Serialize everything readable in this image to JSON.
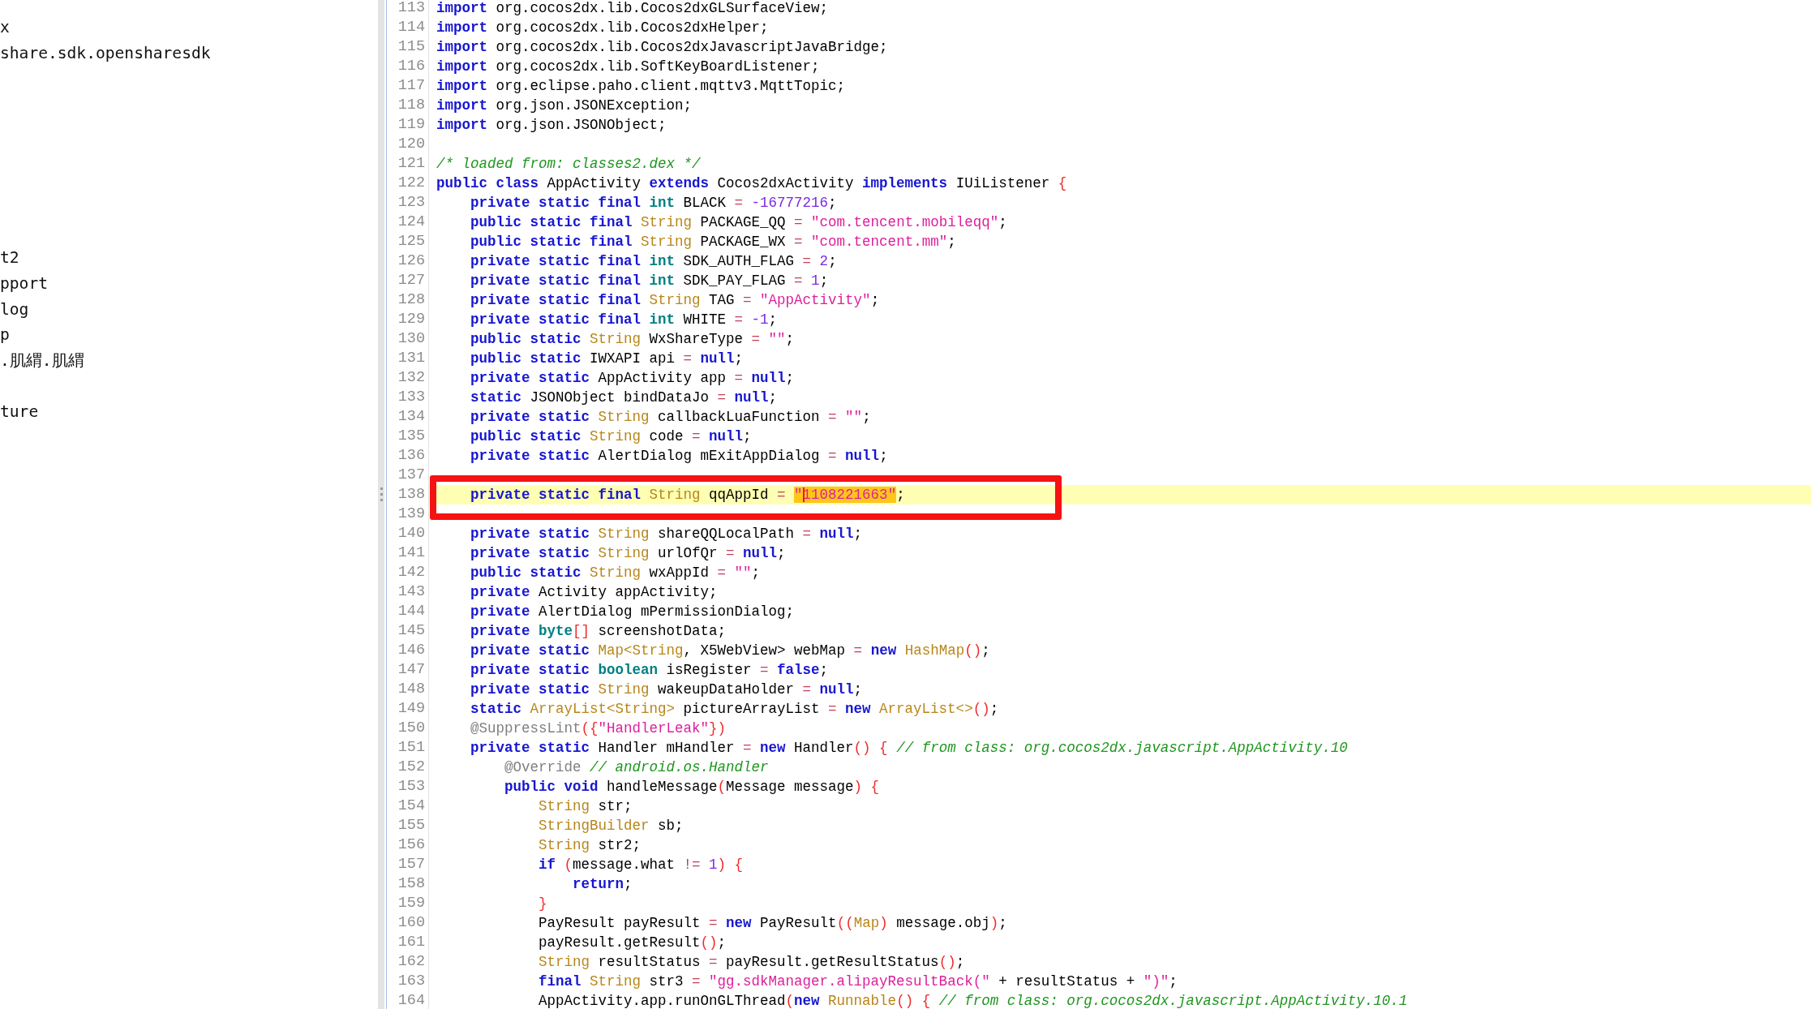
{
  "tree": {
    "items": [
      {
        "label": "x"
      },
      {
        "label": "share.sdk.opensharesdk"
      },
      {
        "label": "t2"
      },
      {
        "label": "pport"
      },
      {
        "label": "log"
      },
      {
        "label": "p"
      },
      {
        "label": ".肌緭.肌緭"
      },
      {
        "label": "ture"
      }
    ]
  },
  "lines": [
    {
      "number": "113",
      "selected": false,
      "boxed": false,
      "tokens": [
        {
          "kind": "kw",
          "text": "import"
        },
        {
          "kind": "plain",
          "text": " org.cocos2dx.lib.Cocos2dxGLSurfaceView;"
        }
      ]
    },
    {
      "number": "114",
      "selected": false,
      "boxed": false,
      "tokens": [
        {
          "kind": "kw",
          "text": "import"
        },
        {
          "kind": "plain",
          "text": " org.cocos2dx.lib.Cocos2dxHelper;"
        }
      ]
    },
    {
      "number": "115",
      "selected": false,
      "boxed": false,
      "tokens": [
        {
          "kind": "kw",
          "text": "import"
        },
        {
          "kind": "plain",
          "text": " org.cocos2dx.lib.Cocos2dxJavascriptJavaBridge;"
        }
      ]
    },
    {
      "number": "116",
      "selected": false,
      "boxed": false,
      "tokens": [
        {
          "kind": "kw",
          "text": "import"
        },
        {
          "kind": "plain",
          "text": " org.cocos2dx.lib.SoftKeyBoardListener;"
        }
      ]
    },
    {
      "number": "117",
      "selected": false,
      "boxed": false,
      "tokens": [
        {
          "kind": "kw",
          "text": "import"
        },
        {
          "kind": "plain",
          "text": " org.eclipse.paho.client.mqttv3.MqttTopic;"
        }
      ]
    },
    {
      "number": "118",
      "selected": false,
      "boxed": false,
      "tokens": [
        {
          "kind": "kw",
          "text": "import"
        },
        {
          "kind": "plain",
          "text": " org.json.JSONException;"
        }
      ]
    },
    {
      "number": "119",
      "selected": false,
      "boxed": false,
      "tokens": [
        {
          "kind": "kw",
          "text": "import"
        },
        {
          "kind": "plain",
          "text": " org.json.JSONObject;"
        }
      ]
    },
    {
      "number": "120",
      "selected": false,
      "boxed": false
    },
    {
      "number": "121",
      "selected": false,
      "boxed": false,
      "tokens": [
        {
          "kind": "com",
          "text": "/* loaded from: classes2.dex */"
        }
      ]
    },
    {
      "number": "122",
      "selected": false,
      "boxed": false,
      "tokens": [
        {
          "kind": "kw",
          "text": "public class"
        },
        {
          "kind": "plain",
          "text": " AppActivity "
        },
        {
          "kind": "kw",
          "text": "extends"
        },
        {
          "kind": "plain",
          "text": " Cocos2dxActivity "
        },
        {
          "kind": "kw",
          "text": "implements"
        },
        {
          "kind": "plain",
          "text": " IUiListener "
        },
        {
          "kind": "sep",
          "text": "{"
        }
      ],
      "children": [
        {
          "number": "123",
          "selected": false,
          "boxed": false,
          "tokens": [
            {
              "kind": "kw",
              "text": "private static final "
            },
            {
              "kind": "type",
              "text": "int"
            },
            {
              "kind": "plain",
              "text": " BLACK "
            },
            {
              "kind": "op",
              "text": "= "
            },
            {
              "kind": "num",
              "text": "-16777216"
            },
            {
              "kind": "plain",
              "text": ";"
            }
          ]
        },
        {
          "number": "124",
          "selected": false,
          "boxed": false,
          "tokens": [
            {
              "kind": "kw",
              "text": "public static final "
            },
            {
              "kind": "cls",
              "text": "String"
            },
            {
              "kind": "plain",
              "text": " PACKAGE_QQ "
            },
            {
              "kind": "op",
              "text": "= "
            },
            {
              "kind": "str",
              "text": "\"com.tencent.mobileqq\""
            },
            {
              "kind": "plain",
              "text": ";"
            }
          ]
        },
        {
          "number": "125",
          "selected": false,
          "boxed": false,
          "tokens": [
            {
              "kind": "kw",
              "text": "public static final "
            },
            {
              "kind": "cls",
              "text": "String"
            },
            {
              "kind": "plain",
              "text": " PACKAGE_WX "
            },
            {
              "kind": "op",
              "text": "= "
            },
            {
              "kind": "str",
              "text": "\"com.tencent.mm\""
            },
            {
              "kind": "plain",
              "text": ";"
            }
          ]
        },
        {
          "number": "126",
          "selected": false,
          "boxed": false,
          "tokens": [
            {
              "kind": "kw",
              "text": "private static final "
            },
            {
              "kind": "type",
              "text": "int"
            },
            {
              "kind": "plain",
              "text": " SDK_AUTH_FLAG "
            },
            {
              "kind": "op",
              "text": "= "
            },
            {
              "kind": "num",
              "text": "2"
            },
            {
              "kind": "plain",
              "text": ";"
            }
          ]
        },
        {
          "number": "127",
          "selected": false,
          "boxed": false,
          "tokens": [
            {
              "kind": "kw",
              "text": "private static final "
            },
            {
              "kind": "type",
              "text": "int"
            },
            {
              "kind": "plain",
              "text": " SDK_PAY_FLAG "
            },
            {
              "kind": "op",
              "text": "= "
            },
            {
              "kind": "num",
              "text": "1"
            },
            {
              "kind": "plain",
              "text": ";"
            }
          ]
        },
        {
          "number": "128",
          "selected": false,
          "boxed": false,
          "tokens": [
            {
              "kind": "kw",
              "text": "private static final "
            },
            {
              "kind": "cls",
              "text": "String"
            },
            {
              "kind": "plain",
              "text": " TAG "
            },
            {
              "kind": "op",
              "text": "= "
            },
            {
              "kind": "str",
              "text": "\"AppActivity\""
            },
            {
              "kind": "plain",
              "text": ";"
            }
          ]
        },
        {
          "number": "129",
          "selected": false,
          "boxed": false,
          "tokens": [
            {
              "kind": "kw",
              "text": "private static final "
            },
            {
              "kind": "type",
              "text": "int"
            },
            {
              "kind": "plain",
              "text": " WHITE "
            },
            {
              "kind": "op",
              "text": "= "
            },
            {
              "kind": "num",
              "text": "-1"
            },
            {
              "kind": "plain",
              "text": ";"
            }
          ]
        },
        {
          "number": "130",
          "selected": false,
          "boxed": false,
          "tokens": [
            {
              "kind": "kw",
              "text": "public static "
            },
            {
              "kind": "cls",
              "text": "String"
            },
            {
              "kind": "plain",
              "text": " WxShareType "
            },
            {
              "kind": "op",
              "text": "= "
            },
            {
              "kind": "str",
              "text": "\"\""
            },
            {
              "kind": "plain",
              "text": ";"
            }
          ]
        },
        {
          "number": "131",
          "selected": false,
          "boxed": false,
          "tokens": [
            {
              "kind": "kw",
              "text": "public static"
            },
            {
              "kind": "plain",
              "text": " IWXAPI api "
            },
            {
              "kind": "op",
              "text": "= "
            },
            {
              "kind": "kw",
              "text": "null"
            },
            {
              "kind": "plain",
              "text": ";"
            }
          ]
        },
        {
          "number": "132",
          "selected": false,
          "boxed": false,
          "tokens": [
            {
              "kind": "kw",
              "text": "private static"
            },
            {
              "kind": "plain",
              "text": " AppActivity app "
            },
            {
              "kind": "op",
              "text": "= "
            },
            {
              "kind": "kw",
              "text": "null"
            },
            {
              "kind": "plain",
              "text": ";"
            }
          ]
        },
        {
          "number": "133",
          "selected": false,
          "boxed": false,
          "tokens": [
            {
              "kind": "kw",
              "text": "static"
            },
            {
              "kind": "plain",
              "text": " JSONObject bindDataJo "
            },
            {
              "kind": "op",
              "text": "= "
            },
            {
              "kind": "kw",
              "text": "null"
            },
            {
              "kind": "plain",
              "text": ";"
            }
          ]
        },
        {
          "number": "134",
          "selected": false,
          "boxed": false,
          "tokens": [
            {
              "kind": "kw",
              "text": "private static "
            },
            {
              "kind": "cls",
              "text": "String"
            },
            {
              "kind": "plain",
              "text": " callbackLuaFunction "
            },
            {
              "kind": "op",
              "text": "= "
            },
            {
              "kind": "str",
              "text": "\"\""
            },
            {
              "kind": "plain",
              "text": ";"
            }
          ]
        },
        {
          "number": "135",
          "selected": false,
          "boxed": false,
          "tokens": [
            {
              "kind": "kw",
              "text": "public static "
            },
            {
              "kind": "cls",
              "text": "String"
            },
            {
              "kind": "plain",
              "text": " code "
            },
            {
              "kind": "op",
              "text": "= "
            },
            {
              "kind": "kw",
              "text": "null"
            },
            {
              "kind": "plain",
              "text": ";"
            }
          ]
        },
        {
          "number": "136",
          "selected": false,
          "boxed": false,
          "tokens": [
            {
              "kind": "kw",
              "text": "private static"
            },
            {
              "kind": "plain",
              "text": " AlertDialog mExitAppDialog "
            },
            {
              "kind": "op",
              "text": "= "
            },
            {
              "kind": "kw",
              "text": "null"
            },
            {
              "kind": "plain",
              "text": ";"
            }
          ]
        },
        {
          "number": "137",
          "selected": false,
          "boxed": false
        },
        {
          "number": "138",
          "selected": true,
          "boxed": true,
          "tokens": [
            {
              "kind": "kw",
              "text": "private static final "
            },
            {
              "kind": "cls",
              "text": "String"
            },
            {
              "kind": "plain",
              "text": " qqAppId "
            },
            {
              "kind": "op",
              "text": "= "
            },
            {
              "kind": "match",
              "text": "\""
            },
            {
              "kind": "caret"
            },
            {
              "kind": "match",
              "text": "1108221663\""
            },
            {
              "kind": "plain",
              "text": ";"
            }
          ]
        },
        {
          "number": "139",
          "selected": false,
          "boxed": false
        },
        {
          "number": "140",
          "selected": false,
          "boxed": false,
          "tokens": [
            {
              "kind": "kw",
              "text": "private static "
            },
            {
              "kind": "cls",
              "text": "String"
            },
            {
              "kind": "plain",
              "text": " shareQQLocalPath "
            },
            {
              "kind": "op",
              "text": "= "
            },
            {
              "kind": "kw",
              "text": "null"
            },
            {
              "kind": "plain",
              "text": ";"
            }
          ]
        },
        {
          "number": "141",
          "selected": false,
          "boxed": false,
          "tokens": [
            {
              "kind": "kw",
              "text": "private static "
            },
            {
              "kind": "cls",
              "text": "String"
            },
            {
              "kind": "plain",
              "text": " urlOfQr "
            },
            {
              "kind": "op",
              "text": "= "
            },
            {
              "kind": "kw",
              "text": "null"
            },
            {
              "kind": "plain",
              "text": ";"
            }
          ]
        },
        {
          "number": "142",
          "selected": false,
          "boxed": false,
          "tokens": [
            {
              "kind": "kw",
              "text": "public static "
            },
            {
              "kind": "cls",
              "text": "String"
            },
            {
              "kind": "plain",
              "text": " wxAppId "
            },
            {
              "kind": "op",
              "text": "= "
            },
            {
              "kind": "str",
              "text": "\"\""
            },
            {
              "kind": "plain",
              "text": ";"
            }
          ]
        },
        {
          "number": "143",
          "selected": false,
          "boxed": false,
          "tokens": [
            {
              "kind": "kw",
              "text": "private"
            },
            {
              "kind": "plain",
              "text": " Activity appActivity;"
            }
          ]
        },
        {
          "number": "144",
          "selected": false,
          "boxed": false,
          "tokens": [
            {
              "kind": "kw",
              "text": "private"
            },
            {
              "kind": "plain",
              "text": " AlertDialog mPermissionDialog;"
            }
          ]
        },
        {
          "number": "145",
          "selected": false,
          "boxed": false,
          "tokens": [
            {
              "kind": "kw",
              "text": "private "
            },
            {
              "kind": "type",
              "text": "byte"
            },
            {
              "kind": "sep",
              "text": "[]"
            },
            {
              "kind": "plain",
              "text": " screenshotData;"
            }
          ]
        },
        {
          "number": "146",
          "selected": false,
          "boxed": false,
          "tokens": [
            {
              "kind": "kw",
              "text": "private static "
            },
            {
              "kind": "cls",
              "text": "Map<String"
            },
            {
              "kind": "plain",
              "text": ", X5WebView> webMap "
            },
            {
              "kind": "op",
              "text": "= "
            },
            {
              "kind": "kw",
              "text": "new "
            },
            {
              "kind": "cls",
              "text": "HashMap"
            },
            {
              "kind": "sep",
              "text": "()"
            },
            {
              "kind": "plain",
              "text": ";"
            }
          ]
        },
        {
          "number": "147",
          "selected": false,
          "boxed": false,
          "tokens": [
            {
              "kind": "kw",
              "text": "private static "
            },
            {
              "kind": "type",
              "text": "boolean"
            },
            {
              "kind": "plain",
              "text": " isRegister "
            },
            {
              "kind": "op",
              "text": "= "
            },
            {
              "kind": "kw",
              "text": "false"
            },
            {
              "kind": "plain",
              "text": ";"
            }
          ]
        },
        {
          "number": "148",
          "selected": false,
          "boxed": false,
          "tokens": [
            {
              "kind": "kw",
              "text": "private static "
            },
            {
              "kind": "cls",
              "text": "String"
            },
            {
              "kind": "plain",
              "text": " wakeupDataHolder "
            },
            {
              "kind": "op",
              "text": "= "
            },
            {
              "kind": "kw",
              "text": "null"
            },
            {
              "kind": "plain",
              "text": ";"
            }
          ]
        },
        {
          "number": "149",
          "selected": false,
          "boxed": false,
          "tokens": [
            {
              "kind": "kw",
              "text": "static "
            },
            {
              "kind": "cls",
              "text": "ArrayList<String>"
            },
            {
              "kind": "plain",
              "text": " pictureArrayList "
            },
            {
              "kind": "op",
              "text": "= "
            },
            {
              "kind": "kw",
              "text": "new "
            },
            {
              "kind": "cls",
              "text": "ArrayList<>"
            },
            {
              "kind": "sep",
              "text": "()"
            },
            {
              "kind": "plain",
              "text": ";"
            }
          ]
        },
        {
          "number": "150",
          "selected": false,
          "boxed": false,
          "tokens": [
            {
              "kind": "ann",
              "text": "@SuppressLint"
            },
            {
              "kind": "sep",
              "text": "({"
            },
            {
              "kind": "str",
              "text": "\"HandlerLeak\""
            },
            {
              "kind": "sep",
              "text": "})"
            }
          ]
        },
        {
          "number": "151",
          "selected": false,
          "boxed": false,
          "tokens": [
            {
              "kind": "kw",
              "text": "private static"
            },
            {
              "kind": "plain",
              "text": " Handler mHandler "
            },
            {
              "kind": "op",
              "text": "= "
            },
            {
              "kind": "kw",
              "text": "new"
            },
            {
              "kind": "plain",
              "text": " Handler"
            },
            {
              "kind": "sep",
              "text": "() {"
            },
            {
              "kind": "com",
              "text": " // from class: org.cocos2dx.javascript.AppActivity.10"
            }
          ],
          "children": [
            {
              "number": "152",
              "selected": false,
              "boxed": false,
              "tokens": [
                {
                  "kind": "ann",
                  "text": "@Override"
                },
                {
                  "kind": "com",
                  "text": " // android.os.Handler"
                }
              ]
            },
            {
              "number": "153",
              "selected": false,
              "boxed": false,
              "tokens": [
                {
                  "kind": "kw",
                  "text": "public void"
                },
                {
                  "kind": "plain",
                  "text": " handleMessage"
                },
                {
                  "kind": "sep",
                  "text": "("
                },
                {
                  "kind": "plain",
                  "text": "Message message"
                },
                {
                  "kind": "sep",
                  "text": ") {"
                }
              ],
              "children": [
                {
                  "number": "154",
                  "selected": false,
                  "boxed": false,
                  "tokens": [
                    {
                      "kind": "cls",
                      "text": "String"
                    },
                    {
                      "kind": "plain",
                      "text": " str;"
                    }
                  ]
                },
                {
                  "number": "155",
                  "selected": false,
                  "boxed": false,
                  "tokens": [
                    {
                      "kind": "cls",
                      "text": "StringBuilder"
                    },
                    {
                      "kind": "plain",
                      "text": " sb;"
                    }
                  ]
                },
                {
                  "number": "156",
                  "selected": false,
                  "boxed": false,
                  "tokens": [
                    {
                      "kind": "cls",
                      "text": "String"
                    },
                    {
                      "kind": "plain",
                      "text": " str2;"
                    }
                  ]
                },
                {
                  "number": "157",
                  "selected": false,
                  "boxed": false,
                  "tokens": [
                    {
                      "kind": "kw",
                      "text": "if"
                    },
                    {
                      "kind": "sep",
                      "text": " ("
                    },
                    {
                      "kind": "plain",
                      "text": "message.what "
                    },
                    {
                      "kind": "op",
                      "text": "!= "
                    },
                    {
                      "kind": "num",
                      "text": "1"
                    },
                    {
                      "kind": "sep",
                      "text": ") {"
                    }
                  ],
                  "children": [
                    {
                      "number": "158",
                      "selected": false,
                      "boxed": false,
                      "tokens": [
                        {
                          "kind": "kw",
                          "text": "return"
                        },
                        {
                          "kind": "plain",
                          "text": ";"
                        }
                      ]
                    }
                  ]
                },
                {
                  "number": "159",
                  "selected": false,
                  "boxed": false,
                  "tokens": [
                    {
                      "kind": "sep",
                      "text": "}"
                    }
                  ]
                },
                {
                  "number": "160",
                  "selected": false,
                  "boxed": false,
                  "tokens": [
                    {
                      "kind": "plain",
                      "text": "PayResult payResult "
                    },
                    {
                      "kind": "op",
                      "text": "= "
                    },
                    {
                      "kind": "kw",
                      "text": "new"
                    },
                    {
                      "kind": "plain",
                      "text": " PayResult"
                    },
                    {
                      "kind": "sep",
                      "text": "(("
                    },
                    {
                      "kind": "cls",
                      "text": "Map"
                    },
                    {
                      "kind": "sep",
                      "text": ")"
                    },
                    {
                      "kind": "plain",
                      "text": " message.obj"
                    },
                    {
                      "kind": "sep",
                      "text": ")"
                    },
                    {
                      "kind": "plain",
                      "text": ";"
                    }
                  ]
                },
                {
                  "number": "161",
                  "selected": false,
                  "boxed": false,
                  "tokens": [
                    {
                      "kind": "plain",
                      "text": "payResult.getResult"
                    },
                    {
                      "kind": "sep",
                      "text": "()"
                    },
                    {
                      "kind": "plain",
                      "text": ";"
                    }
                  ]
                },
                {
                  "number": "162",
                  "selected": false,
                  "boxed": false,
                  "tokens": [
                    {
                      "kind": "cls",
                      "text": "String"
                    },
                    {
                      "kind": "plain",
                      "text": " resultStatus "
                    },
                    {
                      "kind": "op",
                      "text": "="
                    },
                    {
                      "kind": "plain",
                      "text": " payResult.getResultStatus"
                    },
                    {
                      "kind": "sep",
                      "text": "()"
                    },
                    {
                      "kind": "plain",
                      "text": ";"
                    }
                  ]
                },
                {
                  "number": "163",
                  "selected": false,
                  "boxed": false,
                  "tokens": [
                    {
                      "kind": "kw",
                      "text": "final "
                    },
                    {
                      "kind": "cls",
                      "text": "String"
                    },
                    {
                      "kind": "plain",
                      "text": " str3 "
                    },
                    {
                      "kind": "op",
                      "text": "= "
                    },
                    {
                      "kind": "str",
                      "text": "\"gg.sdkManager.alipayResultBack(\""
                    },
                    {
                      "kind": "plain",
                      "text": " + resultStatus + "
                    },
                    {
                      "kind": "str",
                      "text": "\")\""
                    },
                    {
                      "kind": "plain",
                      "text": ";"
                    }
                  ]
                },
                {
                  "number": "164",
                  "selected": false,
                  "boxed": false,
                  "tokens": [
                    {
                      "kind": "plain",
                      "text": "AppActivity.app.runOnGLThread"
                    },
                    {
                      "kind": "sep",
                      "text": "("
                    },
                    {
                      "kind": "kw",
                      "text": "new "
                    },
                    {
                      "kind": "cls",
                      "text": "Runnable"
                    },
                    {
                      "kind": "sep",
                      "text": "() {"
                    },
                    {
                      "kind": "com",
                      "text": " // from class: org.cocos2dx.javascript.AppActivity.10.1"
                    }
                  ]
                }
              ]
            }
          ]
        }
      ]
    }
  ]
}
